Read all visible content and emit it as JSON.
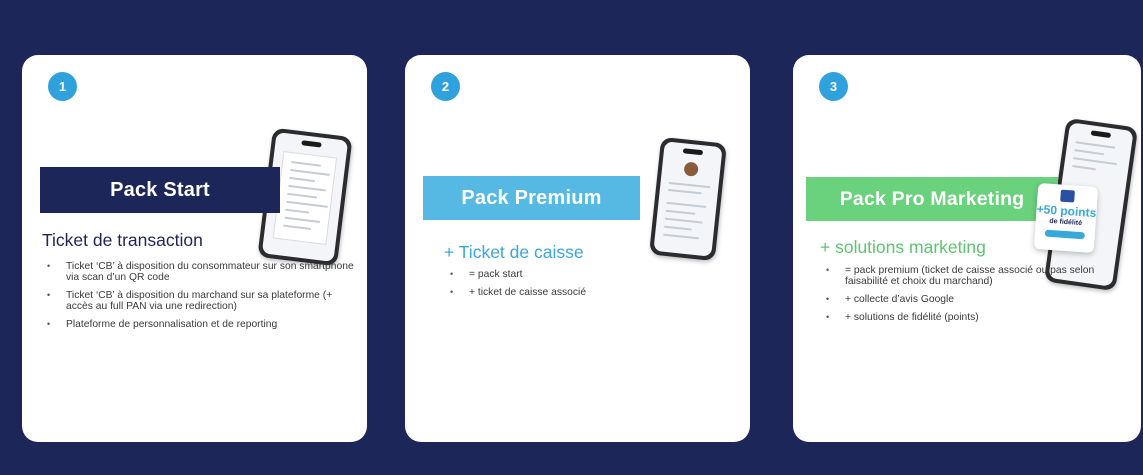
{
  "packs": [
    {
      "step": "1",
      "banner": "Pack Start",
      "subtitle": "Ticket de transaction",
      "bullets": [
        "Ticket ‘CB’ à disposition du consommateur sur son smartphone via scan d’un QR code",
        "Ticket ‘CB’ à disposition du marchand sur sa plateforme (+ accès au full PAN via une redirection)",
        "Plateforme de personnalisation et de reporting"
      ]
    },
    {
      "step": "2",
      "banner": "Pack Premium",
      "subtitle": "+ Ticket de caisse",
      "bullets": [
        "= pack start",
        "+ ticket de caisse associé"
      ]
    },
    {
      "step": "3",
      "banner": "Pack Pro Marketing",
      "subtitle": "+ solutions marketing",
      "bullets": [
        "= pack premium (ticket de caisse associé ou pas selon faisabilité et choix du marchand)",
        "+ collecte d’avis Google",
        "+ solutions de fidélité (points)"
      ],
      "points_popup": {
        "value": "+50 points",
        "label": "de fidélité"
      }
    }
  ],
  "icons": {
    "bullet": "•",
    "phone": "smartphone-mockup-icon"
  },
  "colors": {
    "background": "#1d2658",
    "card": "#ffffff",
    "step_badge": "#2fa1dd",
    "pack_start": "#1d2658",
    "pack_premium": "#55b9e4",
    "pack_pro_marketing": "#6ad17d"
  }
}
